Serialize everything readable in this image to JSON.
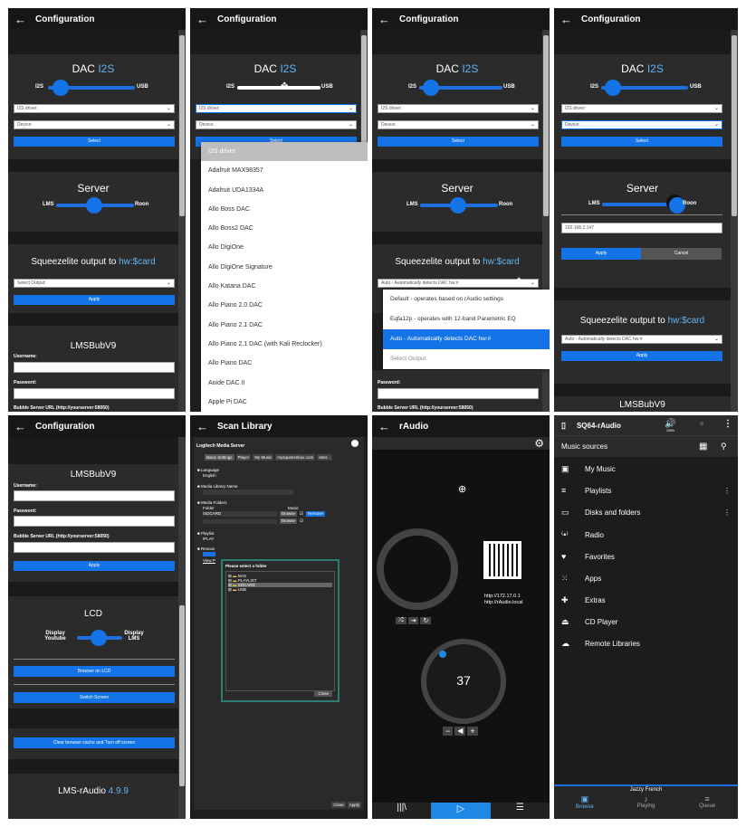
{
  "config": {
    "title": "Configuration",
    "dac_title": "DAC",
    "dac_accent": "I2S",
    "i2s": "I2S",
    "usb": "USB",
    "i2s_driver": "I2S driver:",
    "device": "Device:",
    "select": "Select",
    "server": "Server",
    "lms": "LMS",
    "roon": "Roon",
    "squeeze_text": "Squeezelite output to",
    "squeeze_accent": "hw:$card",
    "select_output": "Select Output:",
    "apply": "Apply",
    "cancel": "Cancel",
    "lmsbub": "LMSBubV9",
    "username": "Username:",
    "password": "Password:",
    "bubble_url": "Bubble Server URL (http://yourserver:58050)",
    "ip_value": "192.168.2.147",
    "auto_value": "Auto - Automatically detects DAC hw:#",
    "lcd": "LCD",
    "display_youtube": "Display Youtube",
    "display_lms": "Display LMS",
    "browser_on_lcd": "Browser on LCD",
    "switch_screen": "Switch Screen",
    "clear_cache": "Clear browser cache and Turn off screen",
    "version_label": "LMS-rAudio",
    "version_num": "4.9.9",
    "dac_list": [
      "I2S driver:",
      "Adafruit MAX98357",
      "Adafruit UDA1334A",
      "Allo Boss DAC",
      "Allo Boss2 DAC",
      "Allo DigiOne",
      "Allo DigiOne Signature",
      "Allo Katana DAC",
      "Allo Piano 2.0 DAC",
      "Allo Piano 2.1 DAC",
      "Allo Piano 2.1 DAC (with Kali Reclocker)",
      "Allo Piano DAC",
      "Aoide DAC II",
      "Apple Pi DAC"
    ],
    "output_list": [
      "Default - operates based on rAudio settings",
      "Eqfa12p - operates with 12-band Parametric EQ",
      "Auto - Automatically detects DAC hw:#",
      "Select Output:"
    ]
  },
  "scan": {
    "title": "Scan Library",
    "server_name": "Logitech Media Server",
    "tabs": [
      "Basic Settings",
      "Player",
      "My Music",
      "mysqueezebox.com",
      "Inter..."
    ],
    "language": "Language",
    "english": "English",
    "lib_name": "Media Library Name",
    "media_folders": "Media Folders",
    "folder": "Folder",
    "music": "Music",
    "sdcard": "/SDCARD",
    "browse": "Browse",
    "remove": "Remove",
    "playlist": "Playlist",
    "playlist_path": "/PLAY",
    "rescan": "Rescan",
    "view": "View P",
    "dialog_title": "Please select a folder",
    "tree": [
      "NAS",
      "PLAYLIST",
      "SDCARD",
      "USB"
    ],
    "close": "Close",
    "apply": "Apply"
  },
  "raudio": {
    "title": "rAudio",
    "url1": "http://172.17.0.1",
    "url2": "http://rAudio.local",
    "volume": "37"
  },
  "lmsui": {
    "player": "SQ64-rAudio",
    "vol_pct": "100%",
    "header": "Music sources",
    "items": [
      "My Music",
      "Playlists",
      "Disks and folders",
      "Radio",
      "Favorites",
      "Apps",
      "Extras",
      "CD Player",
      "Remote Libraries"
    ],
    "now_playing": "Jazzy French",
    "nav": [
      "Browse",
      "Playing",
      "Queue"
    ]
  }
}
